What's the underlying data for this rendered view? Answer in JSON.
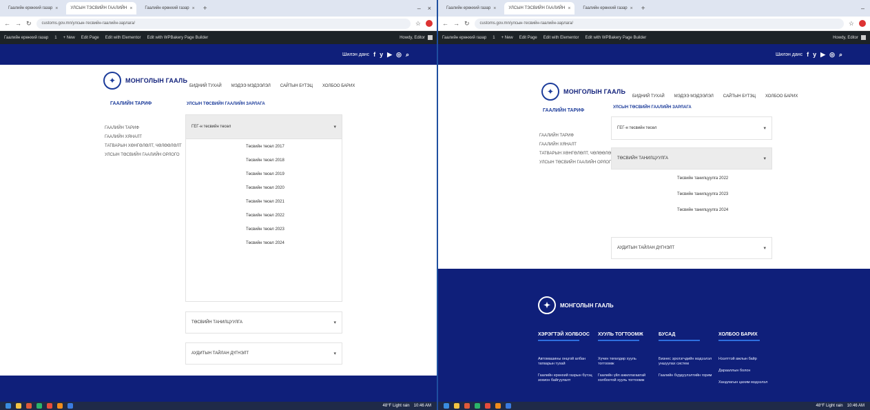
{
  "browser": {
    "tabs_left": [
      "Гаалийн ерөнхий газар",
      "УЛСЫН ТЭСВИЙН ГААЛИЙН",
      "Гаалийн ерөнхий газар"
    ],
    "tabs_right": [
      "Гаалийн ерөнхий газар",
      "УЛСЫН ТЭСВИЙН ГААЛИЙН",
      "Гаалийн ерөнхий газар"
    ],
    "url": "customs.gov.mn/улсын-тесвийн-гаалийн-зарлага/",
    "new_tab": "+",
    "close": "×",
    "minimize": "–",
    "win_close": "×"
  },
  "wp_admin": {
    "site": "Гаалийн ерөнхий газар",
    "count": "1",
    "new": "+ New",
    "edit_page": "Edit Page",
    "elementor": "Edit with Elementor",
    "wpbakery": "Edit with WPBakery Page Builder",
    "howdy": "Howdy, Editor"
  },
  "topnav": {
    "label": "Шилэн данс",
    "socials": [
      "f",
      "y",
      "▶",
      "◎"
    ],
    "search": "⌕"
  },
  "site": {
    "logo_text": "МОНГОЛЫН ГААЛЬ",
    "menu": [
      "БИДНИЙ ТУХАЙ",
      "МЭДЭЭ МЭДЭЭЛЭЛ",
      "САЙТЫН БҮТЭЦ",
      "ХОЛБОО БАРИХ"
    ],
    "section_title": "ГААЛИЙН ТАРИФ",
    "sidebar": [
      "ГААЛИЙН ТАРИФ",
      "ГААЛИЙН ХЯНАЛТ",
      "ТАТВАРЫН ХӨНГӨЛӨЛТ, ЧӨЛӨӨЛӨЛТ",
      "УЛСЫН ТӨСВИЙН ГААЛИЙН ОРЛОГО"
    ],
    "content_title": "УЛСЫН ТӨСВИЙН ГААЛИЙН ЗАРЛАГА"
  },
  "left_panel": {
    "acc1_title": "ГЕГ-н төсвийн төсөл",
    "acc1_items": [
      "Төсвийн төсөл 2017",
      "Төсвийн төсөл 2018",
      "Төсвийн төсөл 2019",
      "Төсвийн төсөл 2020",
      "Төсвийн төсөл 2021",
      "Төсвийн төсөл 2022",
      "Төсвийн төсөл 2023",
      "Төсвийн төсөл 2024"
    ],
    "acc2_title": "ТӨСВИЙН ТАНИЛЦУУЛГА",
    "acc3_title": "АУДИТЫН ТАЙЛАН ДҮГНЭЛТ"
  },
  "right_panel": {
    "acc1_title": "ГЕГ-н төсвийн төсөл",
    "acc2_title": "ТӨСВИЙН ТАНИЛЦУУЛГА",
    "acc2_items": [
      "Төсвийн танилцуулга 2022",
      "Төсвийн танилцуулга 2023",
      "Төсвийн танилцуулга 2024"
    ],
    "acc3_title": "АУДИТЫН ТАЙЛАН ДҮГНЭЛТ"
  },
  "footer": {
    "logo_text": "МОНГОЛЫН ГААЛЬ",
    "cols": [
      "ХЭРЭГТЭЙ ХОЛБООС",
      "ХУУЛЬ ТОГТООМЖ",
      "БУСАД",
      "ХОЛБОО БАРИХ"
    ],
    "col1": [
      "Автомашины онцгой албан татварын тухай",
      "Гаалийн ерөнхий газрын бүтэц зохион байгуулалт"
    ],
    "col2": [
      "Хүчин төгөлдөр хууль тогтоомж",
      "Гаалийн үйл ажиллагаатай холбоотой хууль тогтоомж"
    ],
    "col3": [
      "Бизнес эрхлэгчдийн мэдээлэл уншуулах систем",
      "Гаалийн бүрдүүлэлтийн горим"
    ],
    "col4": [
      "Нээлттэй ажлын байр",
      "Дарааллын болон",
      "Хандлагын цахим мэдээлэл"
    ]
  },
  "taskbar": {
    "weather": "48°F Light rain",
    "time": "10:46 AM"
  }
}
